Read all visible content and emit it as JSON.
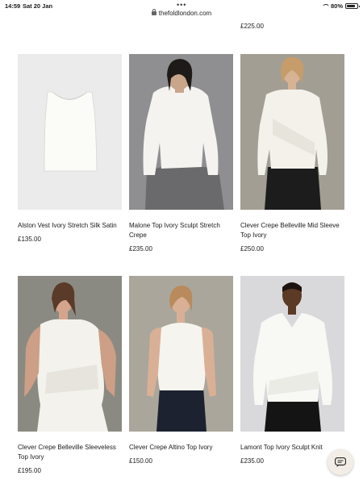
{
  "status_bar": {
    "time": "14:59",
    "date": "Sat 20 Jan",
    "url": "thefoldlondon.com",
    "battery": "80%",
    "battery_level": 0.8
  },
  "previous_row": {
    "price": "£225.00"
  },
  "products": [
    {
      "name": "Alston Vest Ivory Stretch Silk Satin",
      "price": "£135.00"
    },
    {
      "name": "Malone Top Ivory Sculpt Stretch Crepe",
      "price": "£235.00"
    },
    {
      "name": "Clever Crepe Belleville Mid Sleeve Top Ivory",
      "price": "£250.00"
    },
    {
      "name": "Clever Crepe Belleville Sleeveless Top Ivory",
      "price": "£195.00"
    },
    {
      "name": "Clever Crepe Altino Top Ivory",
      "price": "£150.00"
    },
    {
      "name": "Lamont Top Ivory Sculpt Knit",
      "price": "£235.00"
    }
  ],
  "icons": {
    "chat": "chat-bubble-icon",
    "lock": "lock-icon",
    "wifi": "wifi-icon",
    "battery": "battery-icon"
  }
}
